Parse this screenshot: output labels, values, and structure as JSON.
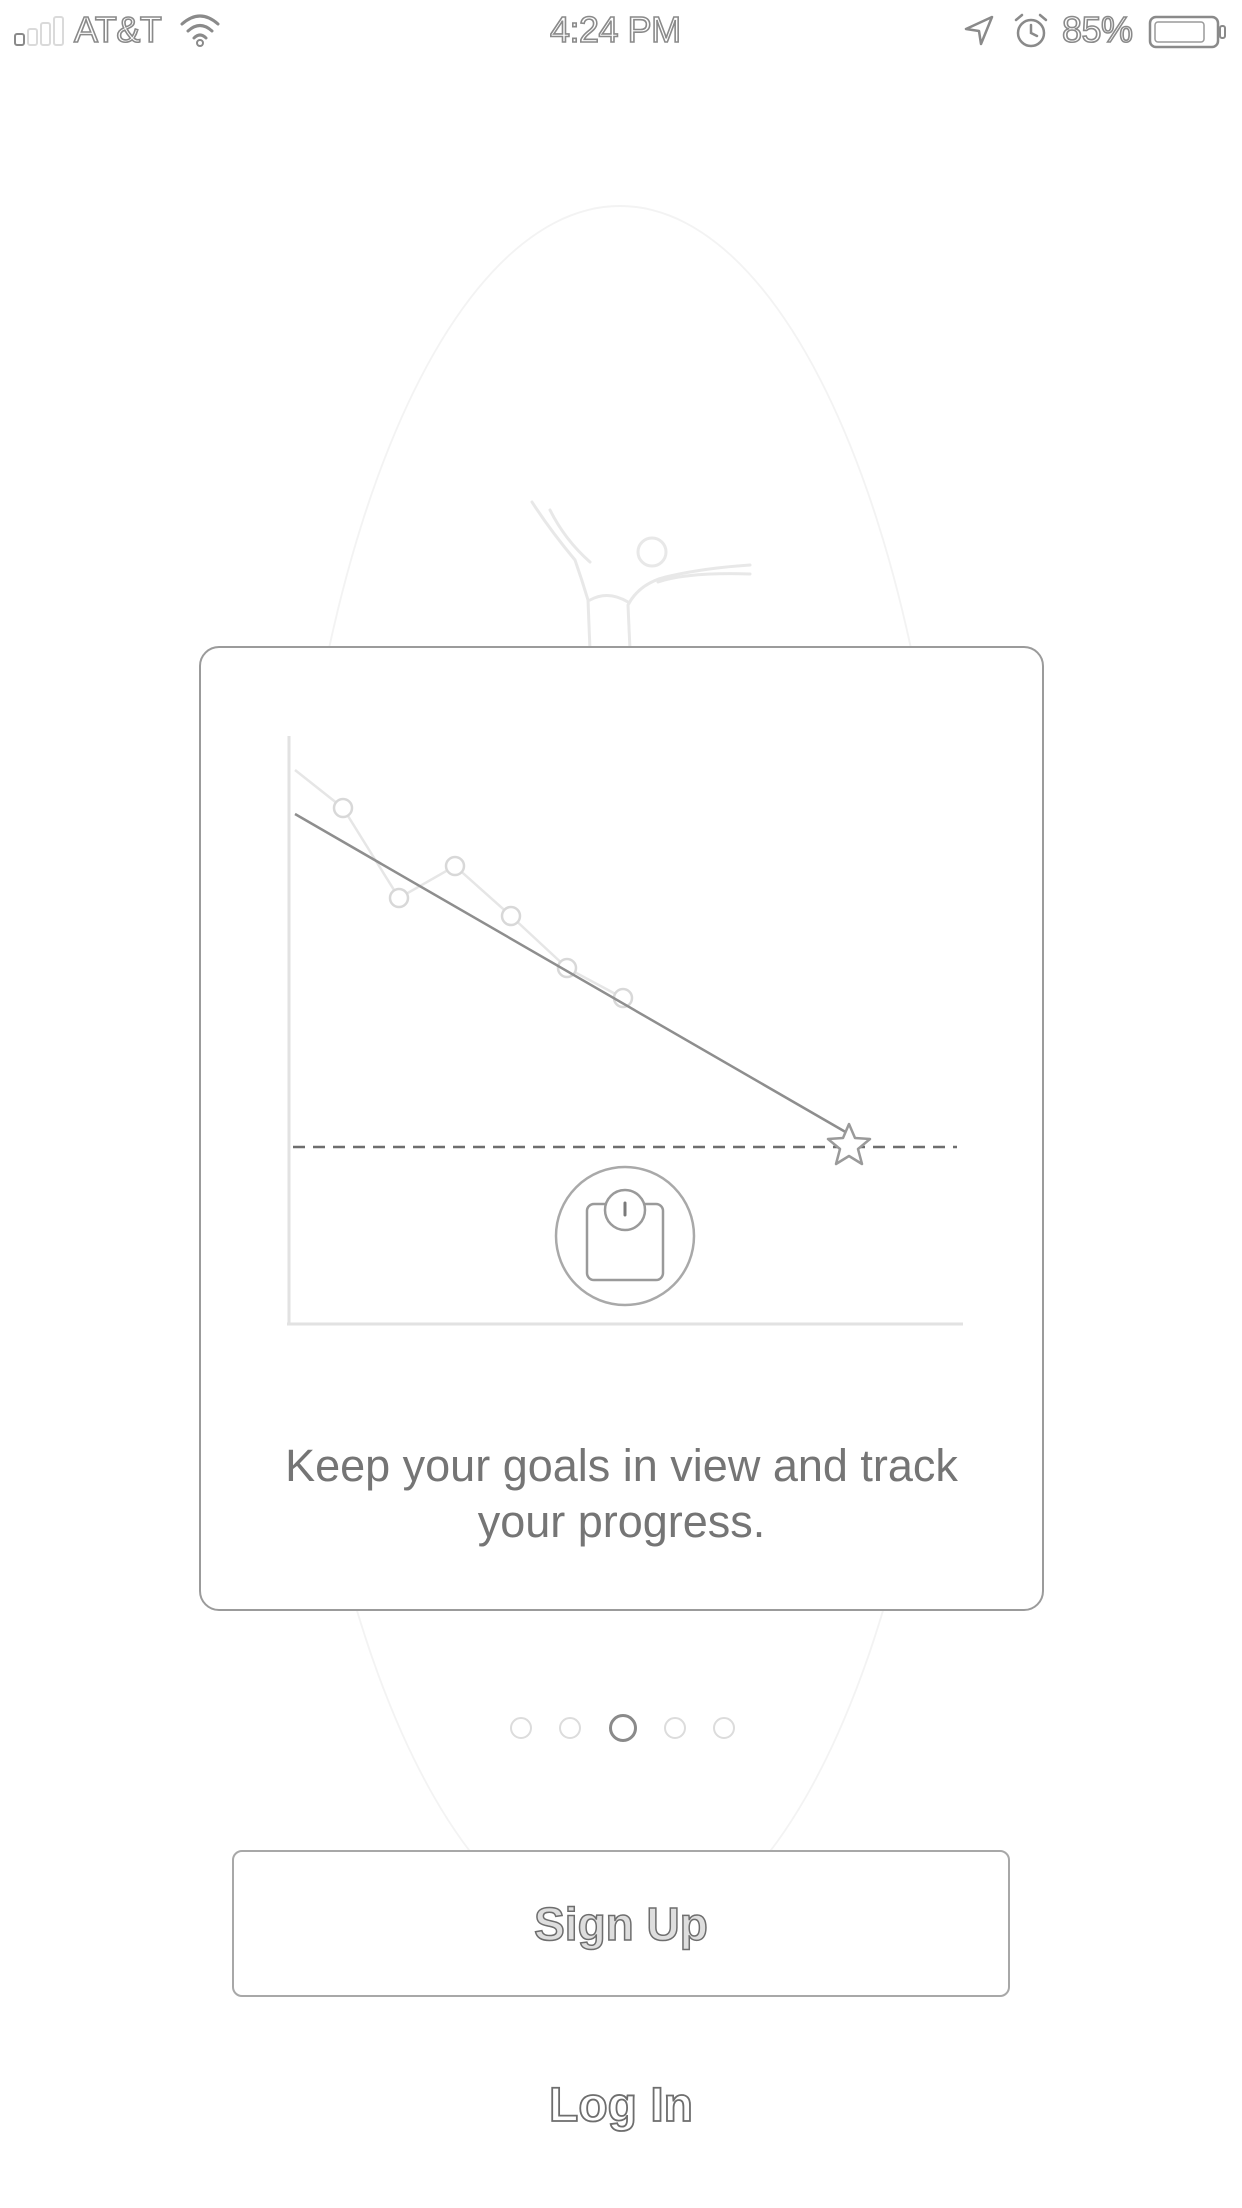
{
  "status_bar": {
    "carrier": "AT&T",
    "time": "4:24 PM",
    "battery_percent": "85%",
    "battery_level": 0.85,
    "signal_bars": 1,
    "icons": [
      "signal-icon",
      "wifi-icon",
      "location-arrow-icon",
      "alarm-icon",
      "battery-icon"
    ]
  },
  "onboarding": {
    "caption": "Keep your goals in view and track your progress.",
    "illustration": [
      "weight-trend-chart",
      "goal-star-icon",
      "scale-icon"
    ],
    "pager": {
      "total": 5,
      "active_index": 2
    }
  },
  "actions": {
    "signup_label": "Sign Up",
    "login_label": "Log In"
  },
  "colors": {
    "background": "#ffffff",
    "card_border": "#9b9b9b",
    "text": "#757575",
    "muted": "#dcdcdc"
  }
}
